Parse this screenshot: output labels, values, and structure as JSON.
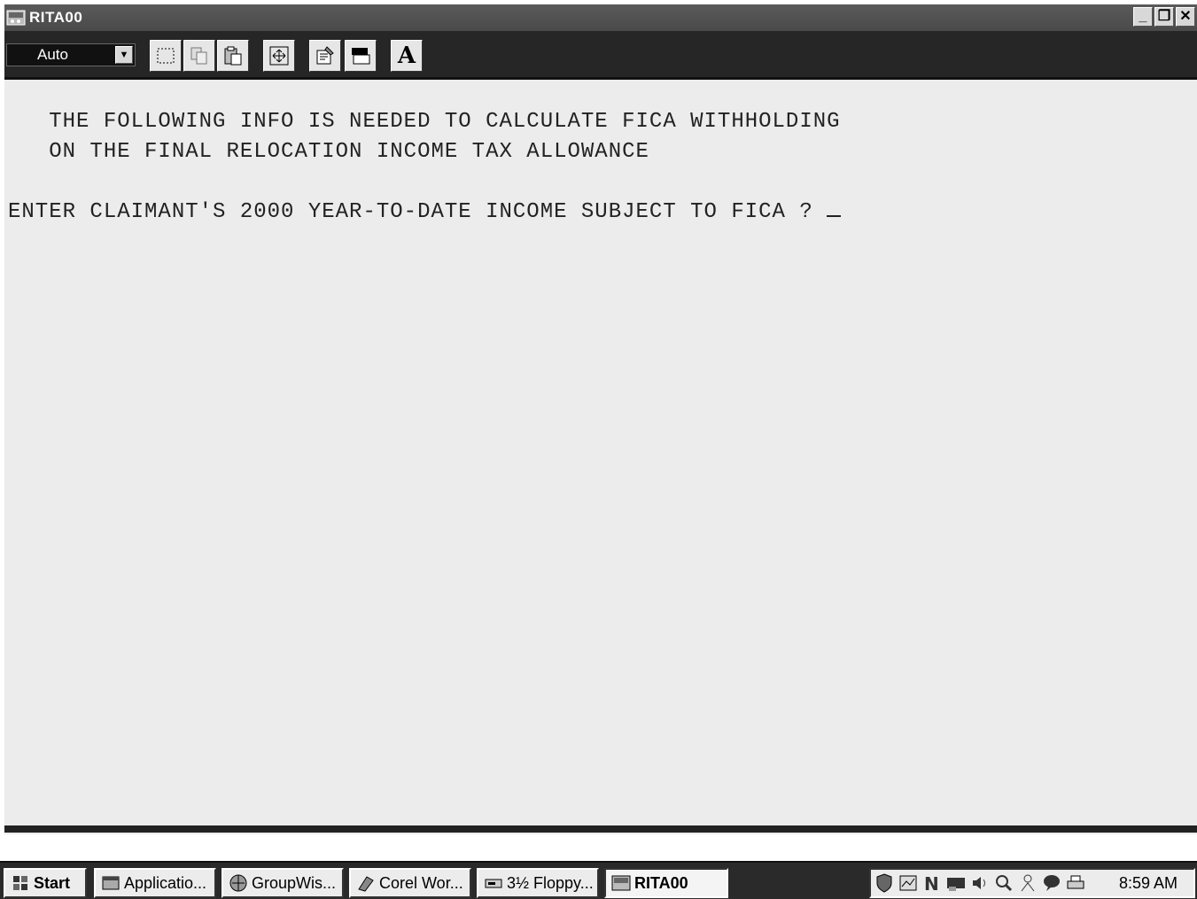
{
  "window": {
    "title": "RITA00",
    "controls": {
      "minimize": "_",
      "restore": "❐",
      "close": "✕"
    }
  },
  "toolbar": {
    "font_size_value": "Auto",
    "buttons": [
      "mark-icon",
      "copy-icon",
      "paste-icon",
      "fullscreen-icon",
      "properties-icon",
      "background-icon",
      "font-icon"
    ]
  },
  "terminal": {
    "lines": [
      "   THE FOLLOWING INFO IS NEEDED TO CALCULATE FICA WITHHOLDING",
      "   ON THE FINAL RELOCATION INCOME TAX ALLOWANCE",
      "ENTER CLAIMANT'S 2000 YEAR-TO-DATE INCOME SUBJECT TO FICA ? "
    ],
    "font_icon_label": "A"
  },
  "taskbar": {
    "start_label": "Start",
    "tasks": [
      {
        "label": "Applicatio...",
        "icon": "application-icon"
      },
      {
        "label": "GroupWis...",
        "icon": "groupwise-icon"
      },
      {
        "label": "Corel Wor...",
        "icon": "corel-icon"
      },
      {
        "label": "3½ Floppy...",
        "icon": "floppy-icon"
      },
      {
        "label": "RITA00",
        "icon": "msdos-icon"
      }
    ],
    "active_task": "RITA00",
    "clock": "8:59 AM"
  },
  "colors": {
    "title_bar": "#4a4a4a",
    "toolbar": "#262626",
    "terminal_bg": "#ececec",
    "terminal_text": "#222222",
    "taskbar": "#2a2a2a"
  }
}
